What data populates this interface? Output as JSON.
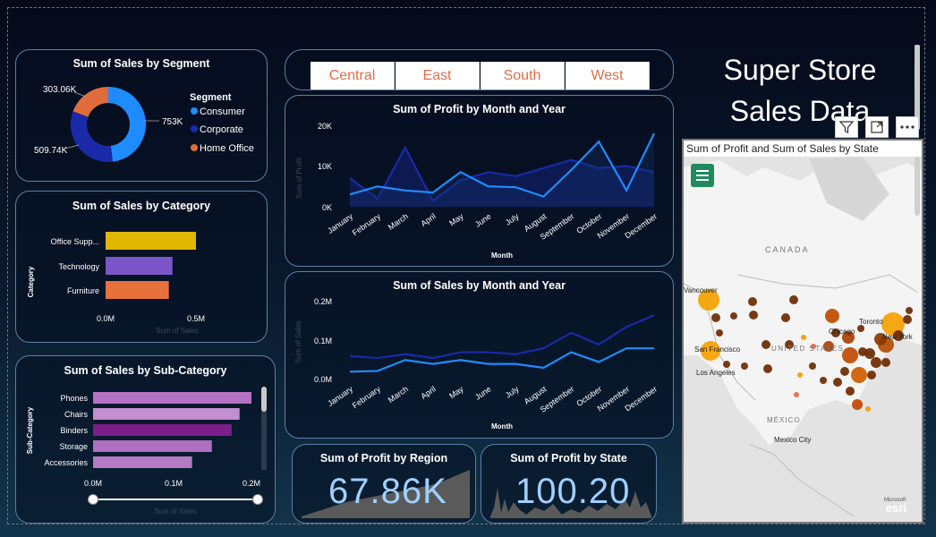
{
  "page_title": "Super Store Sales Data",
  "slicer": [
    "Central",
    "East",
    "South",
    "West"
  ],
  "segment_card": {
    "title": "Sum of Sales by Segment",
    "legend_title": "Segment",
    "legend": [
      "Consumer",
      "Corporate",
      "Home Office"
    ],
    "labels": [
      "753K",
      "509.74K",
      "303.06K"
    ]
  },
  "category_card": {
    "title": "Sum of Sales by Category",
    "axis_label": "Category",
    "categories": [
      "Office Supp...",
      "Technology",
      "Furniture"
    ],
    "ticks": [
      "0.0M",
      "0.5M"
    ],
    "x_axis_title": "Sum of Sales"
  },
  "subcategory_card": {
    "title": "Sum of Sales by Sub-Category",
    "axis_label": "Sub-Category",
    "categories": [
      "Phones",
      "Chairs",
      "Binders",
      "Storage",
      "Accessories"
    ],
    "ticks": [
      "0.0M",
      "0.1M",
      "0.2M"
    ],
    "x_axis_title": "Sum of Sales"
  },
  "profit_line_card": {
    "title": "Sum of Profit by Month and Year",
    "y_axis_title": "Sum of Profit",
    "x_axis_title": "Month",
    "y_ticks": [
      "20K",
      "10K",
      "0K"
    ],
    "months": [
      "January",
      "February",
      "March",
      "April",
      "May",
      "June",
      "July",
      "August",
      "September",
      "October",
      "November",
      "December"
    ]
  },
  "sales_line_card": {
    "title": "Sum of Sales by Month and Year",
    "y_axis_title": "Sum of Sales",
    "x_axis_title": "Month",
    "y_ticks": [
      "0.2M",
      "0.1M",
      "0.0M"
    ],
    "months": [
      "January",
      "February",
      "March",
      "April",
      "May",
      "June",
      "July",
      "August",
      "September",
      "October",
      "November",
      "December"
    ]
  },
  "kpi_region": {
    "title": "Sum of Profit by Region",
    "value": "67.86K"
  },
  "kpi_state": {
    "title": "Sum of Profit by State",
    "value": "100.20"
  },
  "map_card": {
    "title": "Sum of Profit and Sum of Sales by State",
    "place_labels": [
      "CANADA",
      "Vancouver",
      "San Francisco",
      "Los Angeles",
      "UNITED STATES",
      "Chicago",
      "Toronto",
      "New York",
      "MÉXICO",
      "Mexico City"
    ],
    "attribution": "esri",
    "attribution_small": "Microsoft"
  },
  "colors": {
    "consumer": "#1e8cff",
    "corporate": "#1a2aa8",
    "home_office": "#e06c3c",
    "office_supplies": "#e0b800",
    "technology": "#7b55c9",
    "furniture": "#e8703a"
  },
  "chart_data": [
    {
      "type": "pie",
      "title": "Sum of Sales by Segment",
      "categories": [
        "Consumer",
        "Corporate",
        "Home Office"
      ],
      "values": [
        753000,
        509740,
        303060
      ]
    },
    {
      "type": "bar",
      "title": "Sum of Sales by Category",
      "categories": [
        "Office Supp...",
        "Technology",
        "Furniture"
      ],
      "values": [
        0.5,
        0.37,
        0.35
      ],
      "xlim": [
        0,
        0.6
      ]
    },
    {
      "type": "bar",
      "title": "Sum of Sales by Sub-Category",
      "categories": [
        "Phones",
        "Chairs",
        "Binders",
        "Storage",
        "Accessories"
      ],
      "values": [
        0.2,
        0.185,
        0.175,
        0.15,
        0.125
      ],
      "xlim": [
        0,
        0.2
      ]
    },
    {
      "type": "line",
      "title": "Sum of Profit by Month and Year",
      "categories": [
        "January",
        "February",
        "March",
        "April",
        "May",
        "June",
        "July",
        "August",
        "September",
        "October",
        "November",
        "December"
      ],
      "series": [
        {
          "values": [
            7000,
            2000,
            14500,
            1500,
            6500,
            8500,
            7500,
            9500,
            11500,
            9500,
            10000,
            8500
          ]
        },
        {
          "values": [
            3000,
            5000,
            4000,
            3500,
            8500,
            5000,
            4800,
            2500,
            9000,
            16000,
            4000,
            18000
          ]
        }
      ],
      "ylim": [
        0,
        20000
      ]
    },
    {
      "type": "line",
      "title": "Sum of Sales by Month and Year",
      "categories": [
        "January",
        "February",
        "March",
        "April",
        "May",
        "June",
        "July",
        "August",
        "September",
        "October",
        "November",
        "December"
      ],
      "series": [
        {
          "values": [
            0.06,
            0.055,
            0.065,
            0.055,
            0.07,
            0.07,
            0.065,
            0.08,
            0.12,
            0.09,
            0.135,
            0.165
          ]
        },
        {
          "values": [
            0.02,
            0.022,
            0.05,
            0.04,
            0.05,
            0.04,
            0.04,
            0.03,
            0.07,
            0.045,
            0.08,
            0.08
          ]
        }
      ],
      "ylim": [
        0,
        0.2
      ]
    }
  ]
}
